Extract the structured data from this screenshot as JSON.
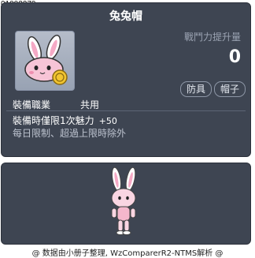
{
  "item_id": "01002279",
  "title": "兔兔帽",
  "power": {
    "label": "戰鬥力提升量",
    "value": "0"
  },
  "tags": [
    "防具",
    "帽子"
  ],
  "job": {
    "label": "裝備職業",
    "value": "共用"
  },
  "stat": {
    "text": "裝備時僅限1次魅力",
    "bonus": "+50"
  },
  "limit_text": "每日限制、超過上限時除外",
  "footer": "@ 数据由小册子整理, WzComparerR2-NTMS解析 @",
  "icons": [
    "bunny-hat-icon",
    "character-preview"
  ],
  "colors": {
    "panel": "#3e4552",
    "text": "#ffffff",
    "muted": "#9ba3b2"
  }
}
